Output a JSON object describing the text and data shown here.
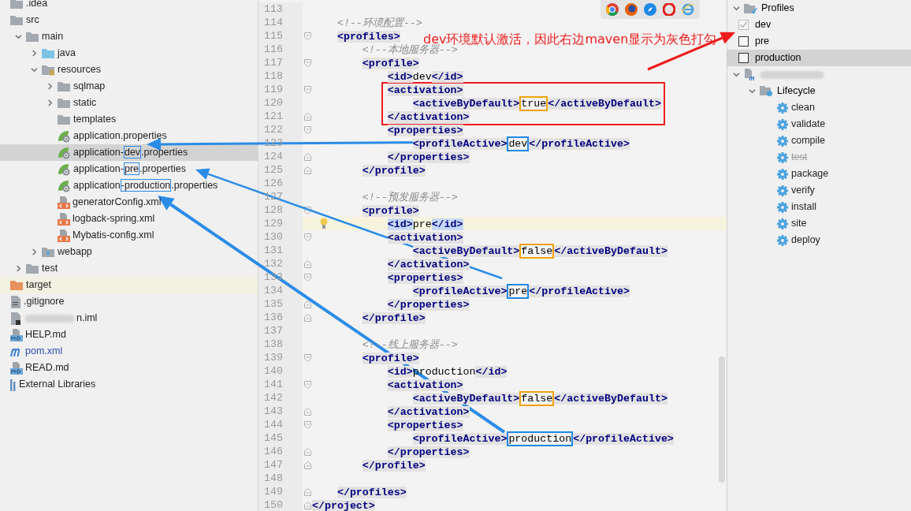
{
  "project_tree": {
    "items": [
      {
        "label": ".idea",
        "kind": "folder",
        "selected": false
      },
      {
        "label": "src",
        "kind": "folder",
        "selected": false,
        "children": [
          {
            "label": "main",
            "kind": "folder",
            "expanded": true,
            "selected": false,
            "children": [
              {
                "label": "java",
                "kind": "source-folder",
                "expanded": false,
                "selected": false
              },
              {
                "label": "resources",
                "kind": "resources-folder",
                "expanded": true,
                "selected": false,
                "children": [
                  {
                    "label": "sqlmap",
                    "kind": "folder",
                    "expanded": false,
                    "selected": false
                  },
                  {
                    "label": "static",
                    "kind": "folder",
                    "expanded": false,
                    "selected": false
                  },
                  {
                    "label": "templates",
                    "kind": "folder",
                    "selected": false
                  },
                  {
                    "label": "application.properties",
                    "kind": "spring-properties",
                    "selected": false
                  },
                  {
                    "label": "application-",
                    "boxed": "dev",
                    "suffix": ".properties",
                    "kind": "spring-properties",
                    "selected": true
                  },
                  {
                    "label": "application-",
                    "boxed": "pre",
                    "suffix": ".properties",
                    "kind": "spring-properties",
                    "selected": false
                  },
                  {
                    "label": "application",
                    "boxed": "-production",
                    "suffix": ".properties",
                    "kind": "spring-properties",
                    "selected": false
                  },
                  {
                    "label": "generatorConfig.xml",
                    "kind": "xml",
                    "selected": false
                  },
                  {
                    "label": "logback-spring.xml",
                    "kind": "xml",
                    "selected": false
                  },
                  {
                    "label": "Mybatis-config.xml",
                    "kind": "xml",
                    "selected": false
                  }
                ]
              },
              {
                "label": "webapp",
                "kind": "web-folder",
                "expanded": false,
                "selected": false
              }
            ]
          },
          {
            "label": "test",
            "kind": "folder",
            "expanded": false,
            "selected": false
          }
        ]
      },
      {
        "label": "target",
        "kind": "output-folder",
        "selected": false
      },
      {
        "label": ".gitignore",
        "kind": "text-file",
        "selected": false
      },
      {
        "label": "n.iml",
        "kind": "module-file",
        "redacted": true,
        "selected": false
      },
      {
        "label": "HELP.md",
        "kind": "markdown",
        "selected": false
      },
      {
        "label": "pom.xml",
        "kind": "maven-pom",
        "selected": false
      },
      {
        "label": "READ.md",
        "kind": "markdown",
        "selected": false
      },
      {
        "label": "External Libraries",
        "kind": "libraries",
        "selected": false
      }
    ]
  },
  "editor": {
    "lines": [
      {
        "number": "113",
        "kind": "plain",
        "current": false
      },
      {
        "number": "114",
        "text": "    <!--环境配置-->",
        "kind": "plain",
        "current": false
      },
      {
        "number": "115",
        "text": "    <profiles>",
        "kind": "fold-start",
        "current": false
      },
      {
        "number": "116",
        "text": "        <!--本地服务器-->",
        "kind": "plain",
        "current": false
      },
      {
        "number": "117",
        "text": "        <profile>",
        "kind": "fold-start",
        "current": false
      },
      {
        "number": "118",
        "text": "            <id>dev</id>",
        "kind": "plain",
        "current": false
      },
      {
        "number": "119",
        "text": "            <activation>",
        "kind": "fold-start",
        "framed": true,
        "current": false
      },
      {
        "number": "120",
        "text": "                <activeByDefault>true</activeByDefault>",
        "kind": "plain",
        "color": "#f0a30a",
        "framed": true,
        "current": false
      },
      {
        "number": "121",
        "text": "            </activation>",
        "kind": "fold-end",
        "framed": true,
        "current": false
      },
      {
        "number": "122",
        "text": "            <properties>",
        "kind": "fold-start",
        "current": false
      },
      {
        "number": "123",
        "text": "                <profileActive>dev</profileActive>",
        "kind": "plain",
        "color": "#1e88e5",
        "current": false
      },
      {
        "number": "124",
        "text": "            </properties>",
        "kind": "fold-end",
        "current": false
      },
      {
        "number": "125",
        "text": "        </profile>",
        "kind": "fold-end",
        "current": false
      },
      {
        "number": "126",
        "kind": "plain",
        "current": false
      },
      {
        "number": "127",
        "text": "        <!--预发服务器-->",
        "kind": "plain",
        "current": false
      },
      {
        "number": "128",
        "text": "        <profile>",
        "kind": "fold-start",
        "current": false
      },
      {
        "number": "129",
        "text": "            <id>pre</id>",
        "kind": "plain",
        "current": true
      },
      {
        "number": "130",
        "text": "            <activation>",
        "kind": "fold-start",
        "current": false
      },
      {
        "number": "131",
        "text": "                <activeByDefault>false</activeByDefault>",
        "kind": "plain",
        "color": "#f0a30a",
        "current": false
      },
      {
        "number": "132",
        "text": "            </activation>",
        "kind": "fold-end",
        "current": false
      },
      {
        "number": "133",
        "text": "            <properties>",
        "kind": "fold-start",
        "current": false
      },
      {
        "number": "134",
        "text": "                <profileActive>pre</profileActive>",
        "kind": "plain",
        "color": "#1e88e5",
        "current": false
      },
      {
        "number": "135",
        "text": "            </properties>",
        "kind": "fold-end",
        "current": false
      },
      {
        "number": "136",
        "text": "        </profile>",
        "kind": "fold-end",
        "current": false
      },
      {
        "number": "137",
        "kind": "plain",
        "current": false
      },
      {
        "number": "138",
        "text": "        <!--线上服务器-->",
        "kind": "plain",
        "current": false
      },
      {
        "number": "139",
        "text": "        <profile>",
        "kind": "fold-start",
        "current": false
      },
      {
        "number": "140",
        "text": "            <id>production</id>",
        "kind": "plain",
        "current": false
      },
      {
        "number": "141",
        "text": "            <activation>",
        "kind": "fold-start",
        "current": false
      },
      {
        "number": "142",
        "text": "                <activeByDefault>false</activeByDefault>",
        "kind": "plain",
        "color": "#f0a30a",
        "current": false
      },
      {
        "number": "143",
        "text": "            </activation>",
        "kind": "fold-end",
        "current": false
      },
      {
        "number": "144",
        "text": "            <properties>",
        "kind": "fold-start",
        "current": false
      },
      {
        "number": "145",
        "text": "                <profileActive>production</profileActive>",
        "kind": "plain",
        "color": "#1e88e5",
        "current": false
      },
      {
        "number": "146",
        "text": "            </properties>",
        "kind": "fold-end",
        "current": false
      },
      {
        "number": "147",
        "text": "        </profile>",
        "kind": "fold-end",
        "current": false
      },
      {
        "number": "148",
        "kind": "plain",
        "current": false
      },
      {
        "number": "149",
        "text": "    </profiles>",
        "kind": "fold-end",
        "current": false
      },
      {
        "number": "150",
        "text": "</project>",
        "kind": "fold-end",
        "current": false
      }
    ]
  },
  "annotation": {
    "text": "dev环境默认激活，因此右边maven显示为灰色打勾"
  },
  "maven_panel": {
    "profiles": {
      "label": "Profiles",
      "expanded": true,
      "items": [
        {
          "label": "dev",
          "checked": true,
          "implicit": true,
          "selected": false
        },
        {
          "label": "pre",
          "checked": false,
          "implicit": false,
          "selected": false
        },
        {
          "label": "production",
          "checked": false,
          "implicit": false,
          "selected": true
        }
      ]
    },
    "project": {
      "redacted": true,
      "expanded": true
    },
    "lifecycle": {
      "label": "Lifecycle",
      "expanded": true,
      "goals": [
        {
          "label": "clean",
          "skipped": false
        },
        {
          "label": "validate",
          "skipped": false
        },
        {
          "label": "compile",
          "skipped": false
        },
        {
          "label": "test",
          "skipped": true
        },
        {
          "label": "package",
          "skipped": false
        },
        {
          "label": "verify",
          "skipped": false
        },
        {
          "label": "install",
          "skipped": false
        },
        {
          "label": "site",
          "skipped": false
        },
        {
          "label": "deploy",
          "skipped": false
        }
      ]
    }
  }
}
